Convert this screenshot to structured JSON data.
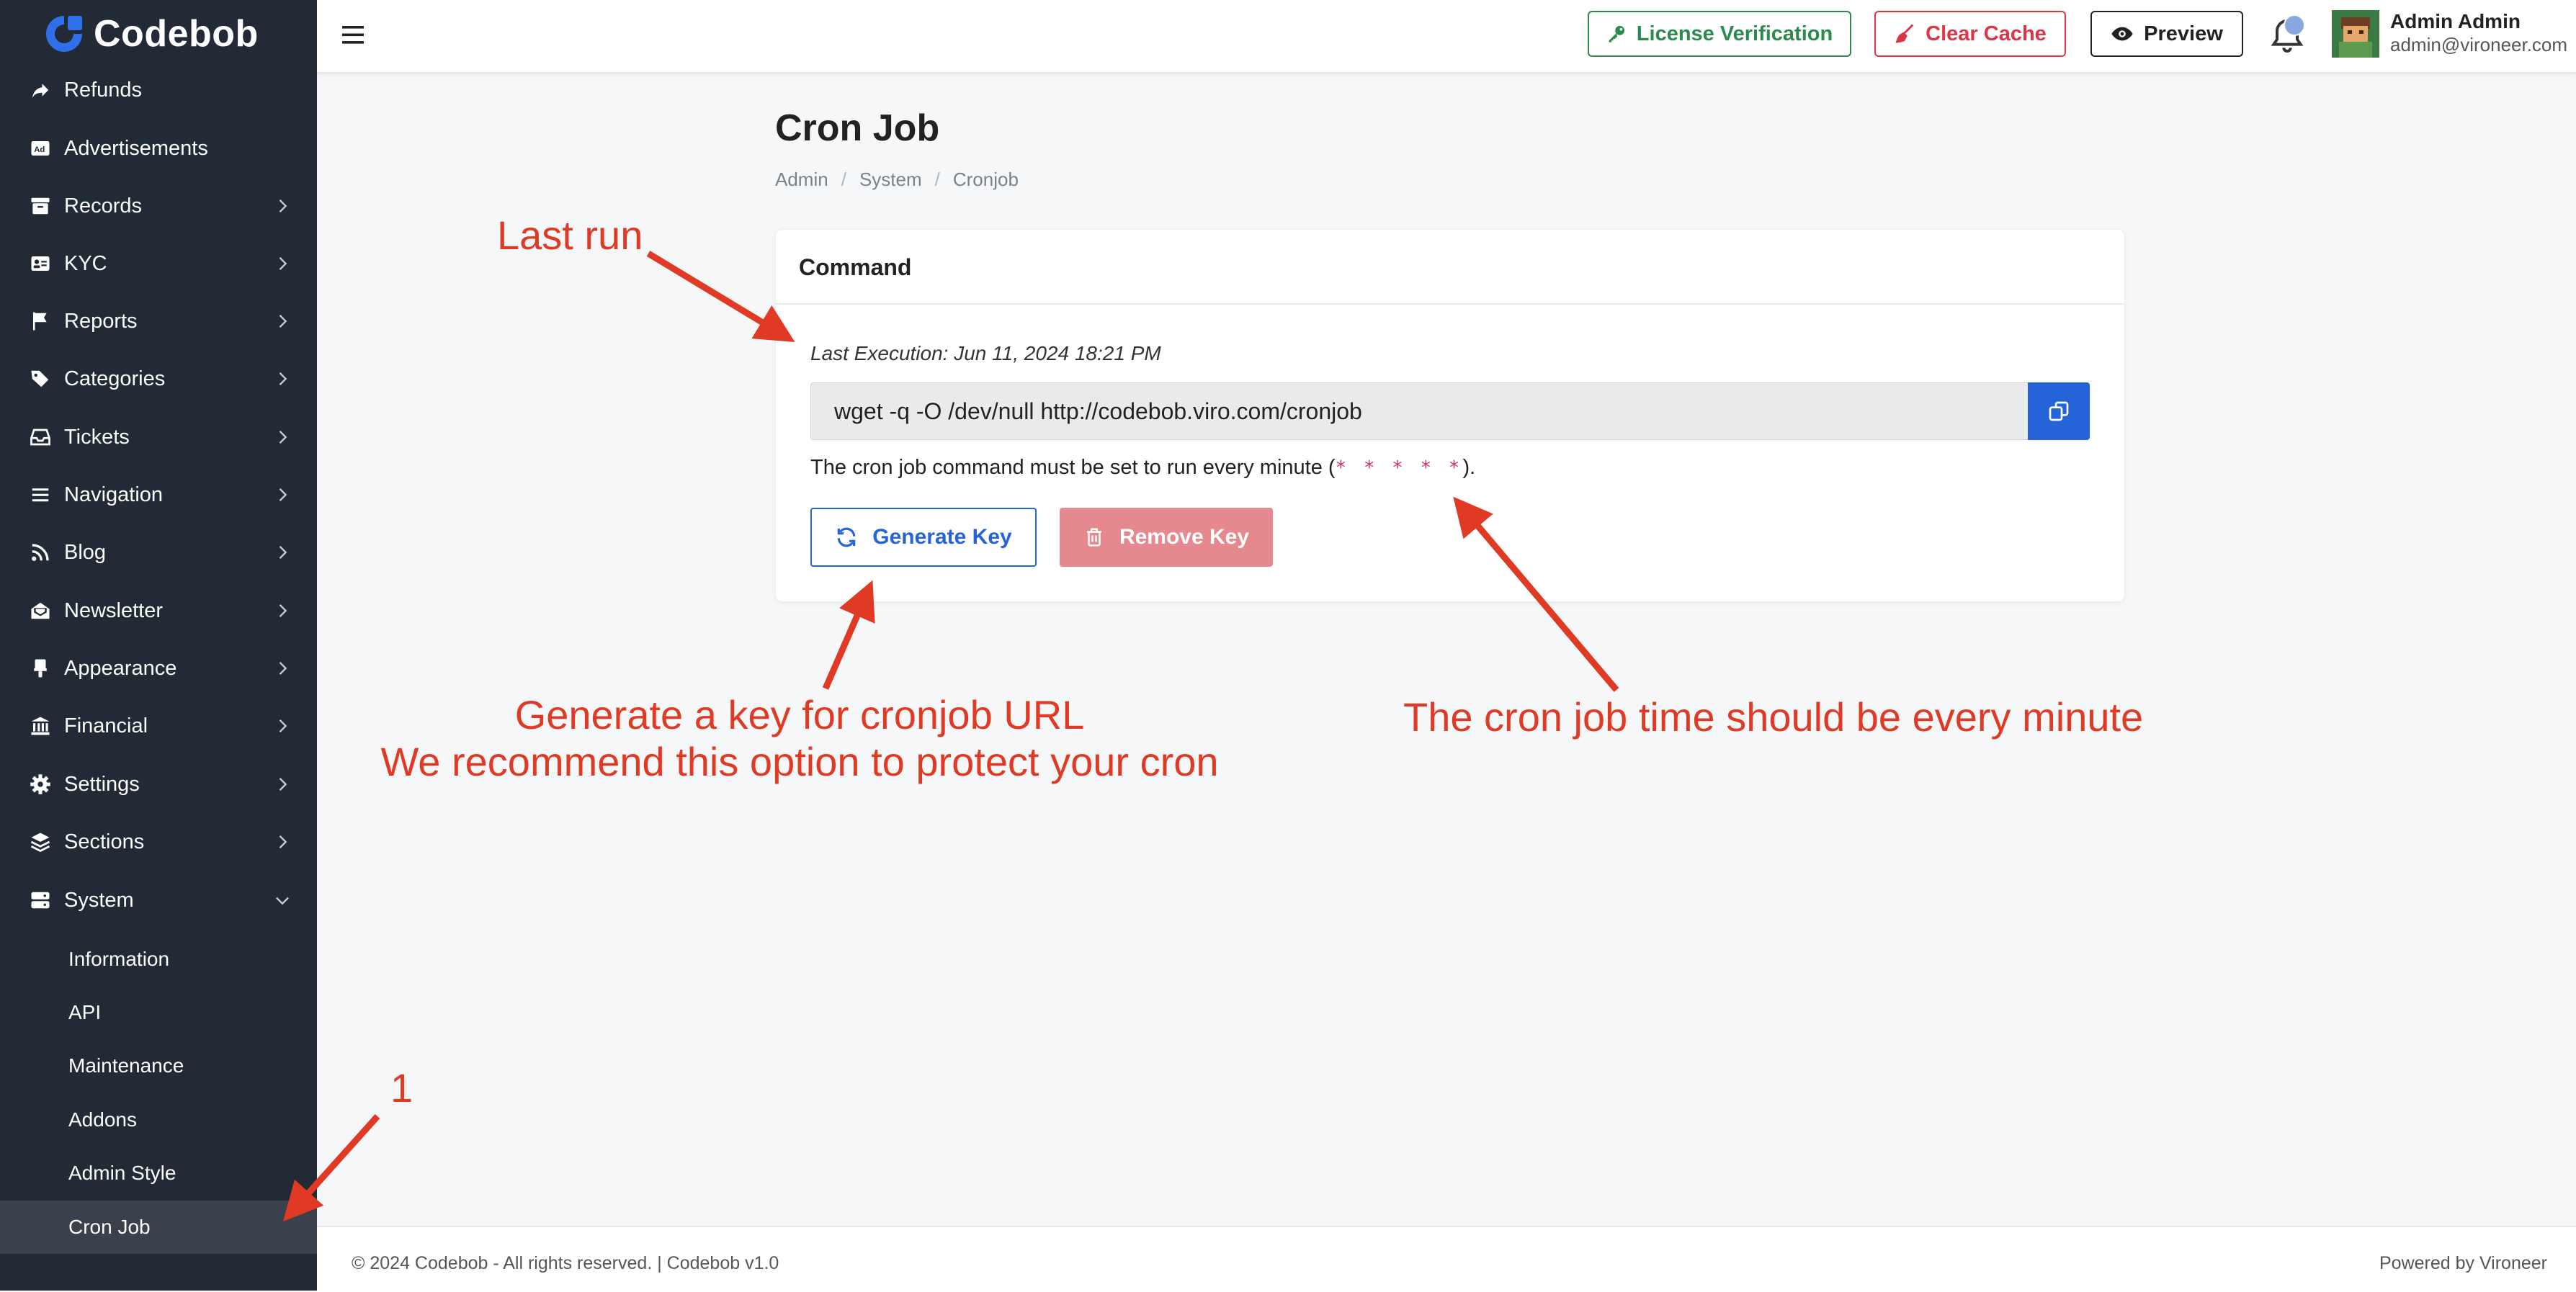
{
  "app": {
    "logo_text": "Codebob"
  },
  "sidebar": {
    "items": [
      {
        "label": "Refunds",
        "icon": "share-icon",
        "has_chevron": false
      },
      {
        "label": "Advertisements",
        "icon": "ad-icon",
        "has_chevron": false
      },
      {
        "label": "Records",
        "icon": "archive-icon",
        "has_chevron": true
      },
      {
        "label": "KYC",
        "icon": "id-card-icon",
        "has_chevron": true
      },
      {
        "label": "Reports",
        "icon": "flag-icon",
        "has_chevron": true
      },
      {
        "label": "Categories",
        "icon": "tags-icon",
        "has_chevron": true
      },
      {
        "label": "Tickets",
        "icon": "inbox-icon",
        "has_chevron": true
      },
      {
        "label": "Navigation",
        "icon": "bars-icon",
        "has_chevron": true
      },
      {
        "label": "Blog",
        "icon": "rss-icon",
        "has_chevron": true
      },
      {
        "label": "Newsletter",
        "icon": "envelope-open-icon",
        "has_chevron": true
      },
      {
        "label": "Appearance",
        "icon": "brush-icon",
        "has_chevron": true
      },
      {
        "label": "Financial",
        "icon": "bank-icon",
        "has_chevron": true
      },
      {
        "label": "Settings",
        "icon": "gear-icon",
        "has_chevron": true
      },
      {
        "label": "Sections",
        "icon": "layers-icon",
        "has_chevron": true
      },
      {
        "label": "System",
        "icon": "server-icon",
        "has_chevron": true,
        "expanded": true
      }
    ],
    "system_children": [
      "Information",
      "API",
      "Maintenance",
      "Addons",
      "Admin Style",
      "Cron Job"
    ],
    "active_child": "Cron Job"
  },
  "topbar": {
    "license_label": "License Verification",
    "cache_label": "Clear Cache",
    "preview_label": "Preview",
    "user_name": "Admin Admin",
    "user_email": "admin@vironeer.com"
  },
  "page": {
    "title": "Cron Job",
    "breadcrumb": [
      "Admin",
      "System",
      "Cronjob"
    ]
  },
  "card": {
    "title": "Command",
    "last_execution": "Last Execution: Jun 11, 2024 18:21 PM",
    "command": "wget -q -O /dev/null http://codebob.viro.com/cronjob",
    "info_prefix": "The cron job command must be set to run every minute (",
    "info_stars": "* * * * *",
    "info_suffix": ").",
    "generate_label": "Generate Key",
    "remove_label": "Remove Key"
  },
  "footer": {
    "left": "© 2024 Codebob - All rights reserved. | Codebob v1.0",
    "right": "Powered by Vironeer"
  },
  "annotations": {
    "last_run": "Last run",
    "generate_line1": "Generate a key for cronjob URL",
    "generate_line2": "We recommend this option to protect your cron",
    "every_minute": "The cron job time should be every minute",
    "step": "1",
    "color": "#e03a24"
  },
  "colors": {
    "sidebar_bg": "#222a35",
    "primary": "#2563d9",
    "success": "#2d8a4e",
    "danger": "#dc3545"
  }
}
